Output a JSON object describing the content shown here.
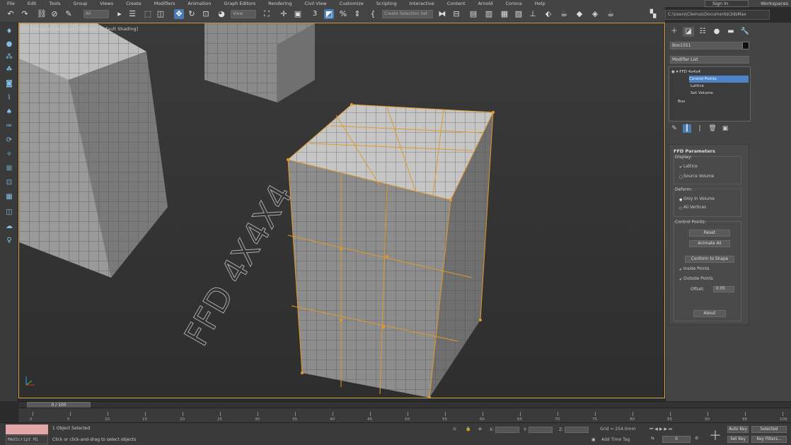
{
  "menu": [
    "File",
    "Edit",
    "Tools",
    "Group",
    "Views",
    "Create",
    "Modifiers",
    "Animation",
    "Graph Editors",
    "Rendering",
    "Civil View",
    "Customize",
    "Scripting",
    "Interactive",
    "Content",
    "Arnold",
    "Corona",
    "Help"
  ],
  "sign_in": "Sign In",
  "workspaces": "Workspaces",
  "toolbar": {
    "filter_value": "All",
    "view_value": "View",
    "snap_label": "3",
    "selection_set_placeholder": "Create Selection Set"
  },
  "path": "C:\\Users\\Clemus\\Documents\\3dsMax",
  "viewport": {
    "label": "[+] [Perspective] [User Defined] [Default Shading]",
    "text_3d": "FFD 4X4X4"
  },
  "panel": {
    "object_name": "Box1551",
    "modifier_list": "Modifier List",
    "stack": [
      "FFD 4x4x4",
      "Control Points",
      "Lattice",
      "Set Volume",
      "Box"
    ],
    "rollout_title": "FFD Parameters",
    "display_title": "Display:",
    "display_options": [
      "Lattice",
      "Source Volume"
    ],
    "deform_title": "Deform:",
    "deform_options": [
      "Only In Volume",
      "All Vertices"
    ],
    "control_points_title": "Control Points:",
    "reset_label": "Reset",
    "animate_all_label": "Animate All",
    "conform_label": "Conform to Shape",
    "inside_points": "Inside Points",
    "outside_points": "Outside Points",
    "offset_label": "Offset:",
    "offset_value": "0.05",
    "about_label": "About"
  },
  "timeline": {
    "slider": "0 / 100",
    "ticks": [
      "0",
      "5",
      "10",
      "15",
      "20",
      "25",
      "30",
      "35",
      "40",
      "45",
      "50",
      "55",
      "60",
      "65",
      "70",
      "75",
      "80",
      "85",
      "90",
      "95",
      "100"
    ]
  },
  "status": {
    "script_label": "MAXScript Mi",
    "selected": "1 Object Selected",
    "hint": "Click or click-and-drag to select objects",
    "x_label": "X:",
    "y_label": "Y:",
    "z_label": "Z:",
    "grid": "Grid = 254.0mm",
    "add_time_tag": "Add Time Tag",
    "auto_key": "Auto Key",
    "selected_dropdown": "Selected",
    "set_key": "Set Key",
    "key_filters": "Key Filters...",
    "frame": "0"
  }
}
